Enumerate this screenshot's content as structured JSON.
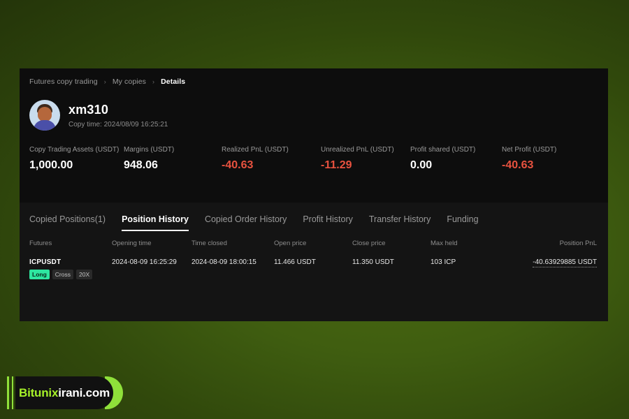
{
  "breadcrumb": {
    "items": [
      "Futures copy trading",
      "My copies",
      "Details"
    ],
    "separator": "›"
  },
  "profile": {
    "username": "xm310",
    "copy_time": "Copy time: 2024/08/09 16:25:21",
    "avatar_icon": "user-avatar-icon"
  },
  "stats": [
    {
      "label": "Copy Trading Assets (USDT)",
      "value": "1,000.00",
      "negative": false
    },
    {
      "label": "Margins (USDT)",
      "value": "948.06",
      "negative": false
    },
    {
      "label": "Realized PnL (USDT)",
      "value": "-40.63",
      "negative": true
    },
    {
      "label": "Unrealized PnL (USDT)",
      "value": "-11.29",
      "negative": true
    },
    {
      "label": "Profit shared (USDT)",
      "value": "0.00",
      "negative": false
    },
    {
      "label": "Net Profit (USDT)",
      "value": "-40.63",
      "negative": true
    }
  ],
  "tabs": [
    {
      "label": "Copied Positions(1)",
      "active": false
    },
    {
      "label": "Position History",
      "active": true
    },
    {
      "label": "Copied Order History",
      "active": false
    },
    {
      "label": "Profit History",
      "active": false
    },
    {
      "label": "Transfer History",
      "active": false
    },
    {
      "label": "Funding",
      "active": false
    }
  ],
  "table": {
    "columns": [
      "Futures",
      "Opening time",
      "Time closed",
      "Open price",
      "Close price",
      "Max held",
      "Position PnL"
    ],
    "rows": [
      {
        "symbol": "ICPUSDT",
        "side_badge": "Long",
        "margin_badge": "Cross",
        "leverage_badge": "20X",
        "opening_time": "2024-08-09 16:25:29",
        "time_closed": "2024-08-09 18:00:15",
        "open_price": "11.466 USDT",
        "close_price": "11.350 USDT",
        "max_held": "103 ICP",
        "position_pnl": "-40.63929885 USDT"
      }
    ]
  },
  "watermark": {
    "brand": "Bitunix",
    "domain": "irani.com"
  },
  "colors": {
    "panel_bg": "#0d0d0d",
    "lower_bg": "#141414",
    "negative": "#e8523f",
    "long_badge": "#2ee6a0",
    "brand_green": "#a6f029"
  }
}
